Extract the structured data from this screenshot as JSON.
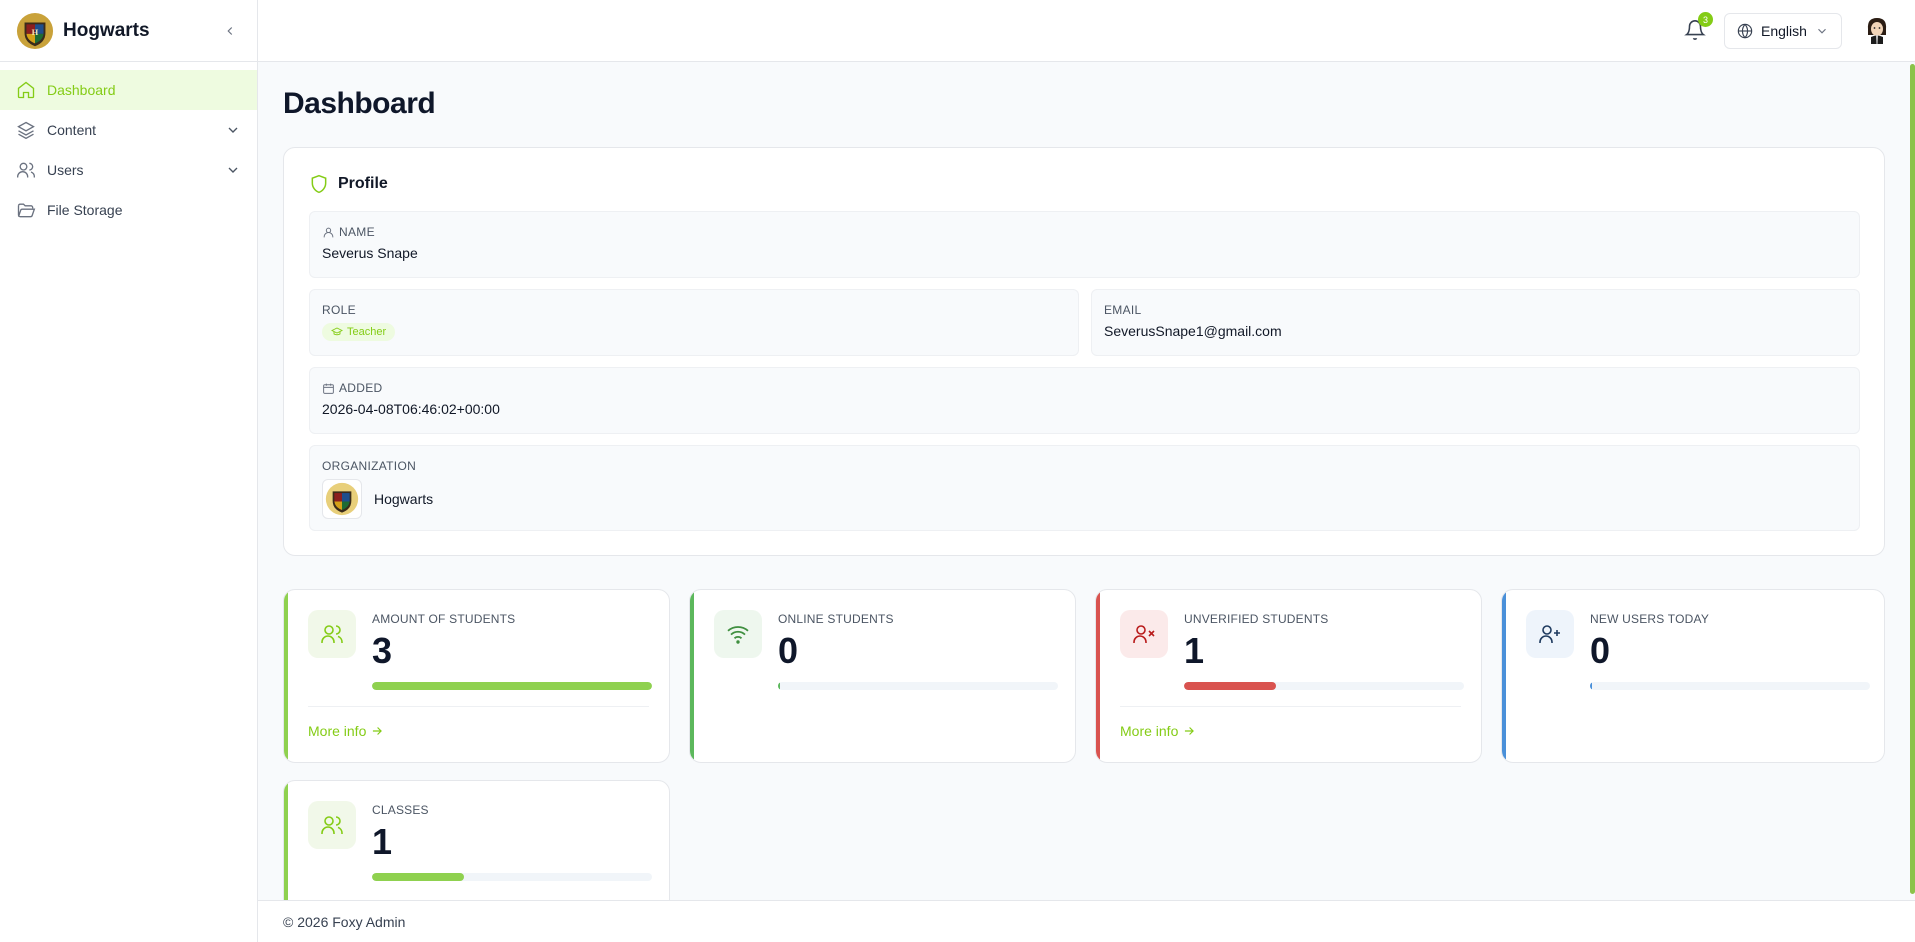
{
  "brand": {
    "name": "Hogwarts"
  },
  "sidebar": {
    "items": [
      {
        "label": "Dashboard",
        "icon": "home-icon",
        "active": true
      },
      {
        "label": "Content",
        "icon": "layers-icon",
        "expandable": true
      },
      {
        "label": "Users",
        "icon": "users-icon",
        "expandable": true
      },
      {
        "label": "File Storage",
        "icon": "folder-open-icon"
      }
    ]
  },
  "header": {
    "notification_count": "3",
    "language": "English"
  },
  "page": {
    "title": "Dashboard"
  },
  "profile": {
    "title": "Profile",
    "name_label": "NAME",
    "name": "Severus Snape",
    "role_label": "ROLE",
    "role": "Teacher",
    "email_label": "EMAIL",
    "email": "SeverusSnape1@gmail.com",
    "added_label": "ADDED",
    "added": "2026-04-08T06:46:02+00:00",
    "organization_label": "ORGANIZATION",
    "organization": "Hogwarts"
  },
  "stats": [
    {
      "label": "AMOUNT OF STUDENTS",
      "value": "3",
      "progress_percent": 100,
      "link": "More info",
      "accent": "#8fd14f",
      "icon": "users-icon"
    },
    {
      "label": "ONLINE STUDENTS",
      "value": "0",
      "progress_percent": 0,
      "accent": "#5cb85c",
      "icon": "wifi-icon"
    },
    {
      "label": "UNVERIFIED STUDENTS",
      "value": "1",
      "progress_percent": 33,
      "link": "More info",
      "accent": "#d9534f",
      "icon": "user-x-icon"
    },
    {
      "label": "NEW USERS TODAY",
      "value": "0",
      "progress_percent": 0,
      "accent": "#4a90d9",
      "icon": "user-plus-icon"
    },
    {
      "label": "CLASSES",
      "value": "1",
      "progress_percent": 33,
      "accent": "#8fd14f",
      "icon": "users-icon"
    }
  ],
  "colors": {
    "primary": "#84cc16",
    "danger": "#d9534f",
    "info": "#4a90d9"
  },
  "footer": {
    "text": "© 2026 Foxy Admin"
  }
}
